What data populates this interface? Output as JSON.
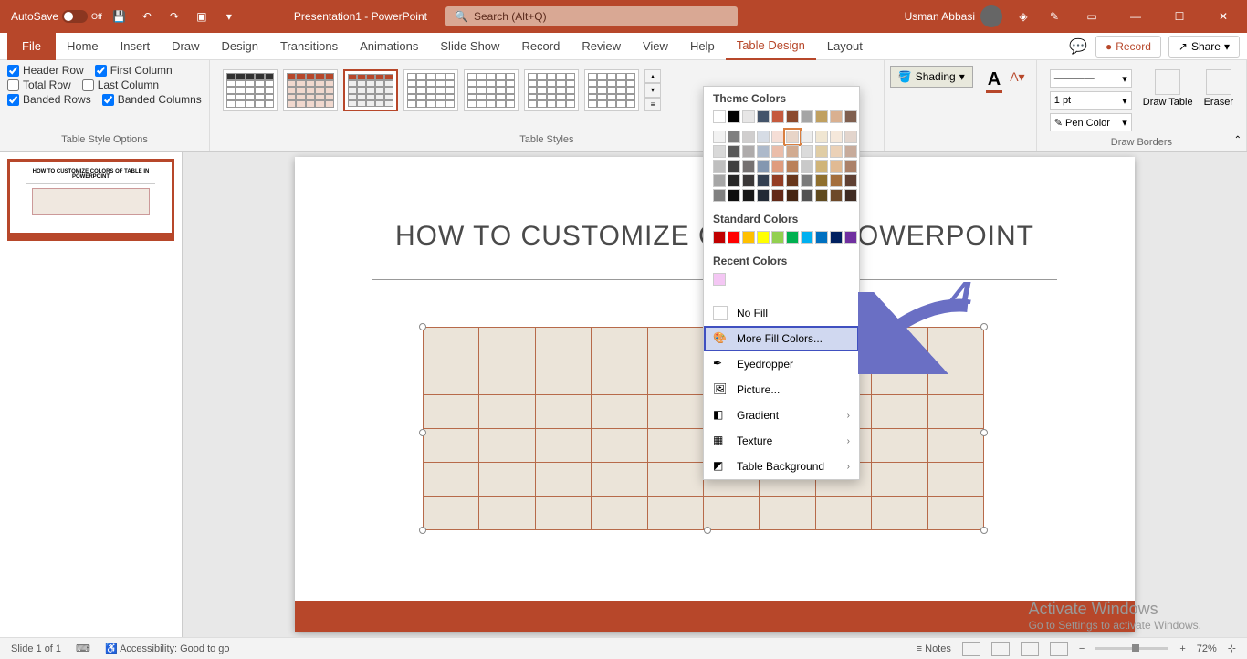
{
  "titlebar": {
    "autosave_label": "AutoSave",
    "autosave_state": "Off",
    "doc_title": "Presentation1 - PowerPoint",
    "search_placeholder": "Search (Alt+Q)",
    "user_name": "Usman Abbasi"
  },
  "tabs": {
    "file": "File",
    "home": "Home",
    "insert": "Insert",
    "draw": "Draw",
    "design": "Design",
    "transitions": "Transitions",
    "animations": "Animations",
    "slide_show": "Slide Show",
    "record": "Record",
    "review": "Review",
    "view": "View",
    "help": "Help",
    "table_design": "Table Design",
    "layout": "Layout"
  },
  "ribbon_right": {
    "comments": "□",
    "record_btn": "Record",
    "share_btn": "Share"
  },
  "style_options": {
    "header_row": "Header Row",
    "total_row": "Total Row",
    "banded_rows": "Banded Rows",
    "first_column": "First Column",
    "last_column": "Last Column",
    "banded_columns": "Banded Columns",
    "group_label": "Table Style Options"
  },
  "checked": {
    "header_row": true,
    "total_row": false,
    "banded_rows": true,
    "first_column": true,
    "last_column": false,
    "banded_columns": true
  },
  "table_styles_label": "Table Styles",
  "shading_label": "Shading",
  "borders": {
    "weight": "1 pt",
    "pen_color": "Pen Color",
    "draw_table": "Draw Table",
    "eraser": "Eraser",
    "group_label": "Draw Borders"
  },
  "dropdown": {
    "theme_colors": "Theme Colors",
    "standard_colors": "Standard Colors",
    "recent_colors": "Recent Colors",
    "no_fill": "No Fill",
    "more_fill": "More Fill Colors...",
    "eyedropper": "Eyedropper",
    "picture": "Picture...",
    "gradient": "Gradient",
    "texture": "Texture",
    "table_bg": "Table Background"
  },
  "theme_row1": [
    "#ffffff",
    "#000000",
    "#e7e6e6",
    "#44546a",
    "#c55a3e",
    "#8b4a2e",
    "#a5a5a5",
    "#c0a060",
    "#d9b090",
    "#7f5f4f"
  ],
  "theme_shades": [
    [
      "#f2f2f2",
      "#7f7f7f",
      "#d0cece",
      "#d6dce5",
      "#f5ded6",
      "#e8d5c8",
      "#ededed",
      "#f0e6d2",
      "#f5e8db",
      "#e3d5cd"
    ],
    [
      "#d9d9d9",
      "#595959",
      "#aeabab",
      "#adb9ca",
      "#eabdaa",
      "#d1ab91",
      "#dbdbdb",
      "#e0cda5",
      "#ebd1b7",
      "#c7ab9b"
    ],
    [
      "#bfbfbf",
      "#404040",
      "#757171",
      "#8497b0",
      "#df9c7e",
      "#ba815a",
      "#c9c9c9",
      "#d0b478",
      "#e1ba93",
      "#ab8169"
    ],
    [
      "#a6a6a6",
      "#262626",
      "#3b3838",
      "#333f50",
      "#943e25",
      "#68371c",
      "#7b7b7b",
      "#8f6f2e",
      "#a36e3d",
      "#5f4033"
    ],
    [
      "#808080",
      "#0d0d0d",
      "#171717",
      "#222a35",
      "#622918",
      "#452512",
      "#525252",
      "#5f4a1f",
      "#6d4929",
      "#3f2b22"
    ]
  ],
  "standard_colors_row": [
    "#c00000",
    "#ff0000",
    "#ffc000",
    "#ffff00",
    "#92d050",
    "#00b050",
    "#00b0f0",
    "#0070c0",
    "#002060",
    "#7030a0"
  ],
  "recent_color": "#f4c7f4",
  "slide": {
    "title": "HOW TO CUSTOMIZE COLOR             N POWERPOINT",
    "thumb_title": "HOW TO CUSTOMIZE COLORS OF TABLE IN POWERPOINT"
  },
  "annotation": {
    "number": "4"
  },
  "watermark": {
    "title": "Activate Windows",
    "sub": "Go to Settings to activate Windows."
  },
  "statusbar": {
    "slide_info": "Slide 1 of 1",
    "accessibility": "Accessibility: Good to go",
    "notes": "Notes",
    "zoom": "72%"
  },
  "slide_number": "1"
}
